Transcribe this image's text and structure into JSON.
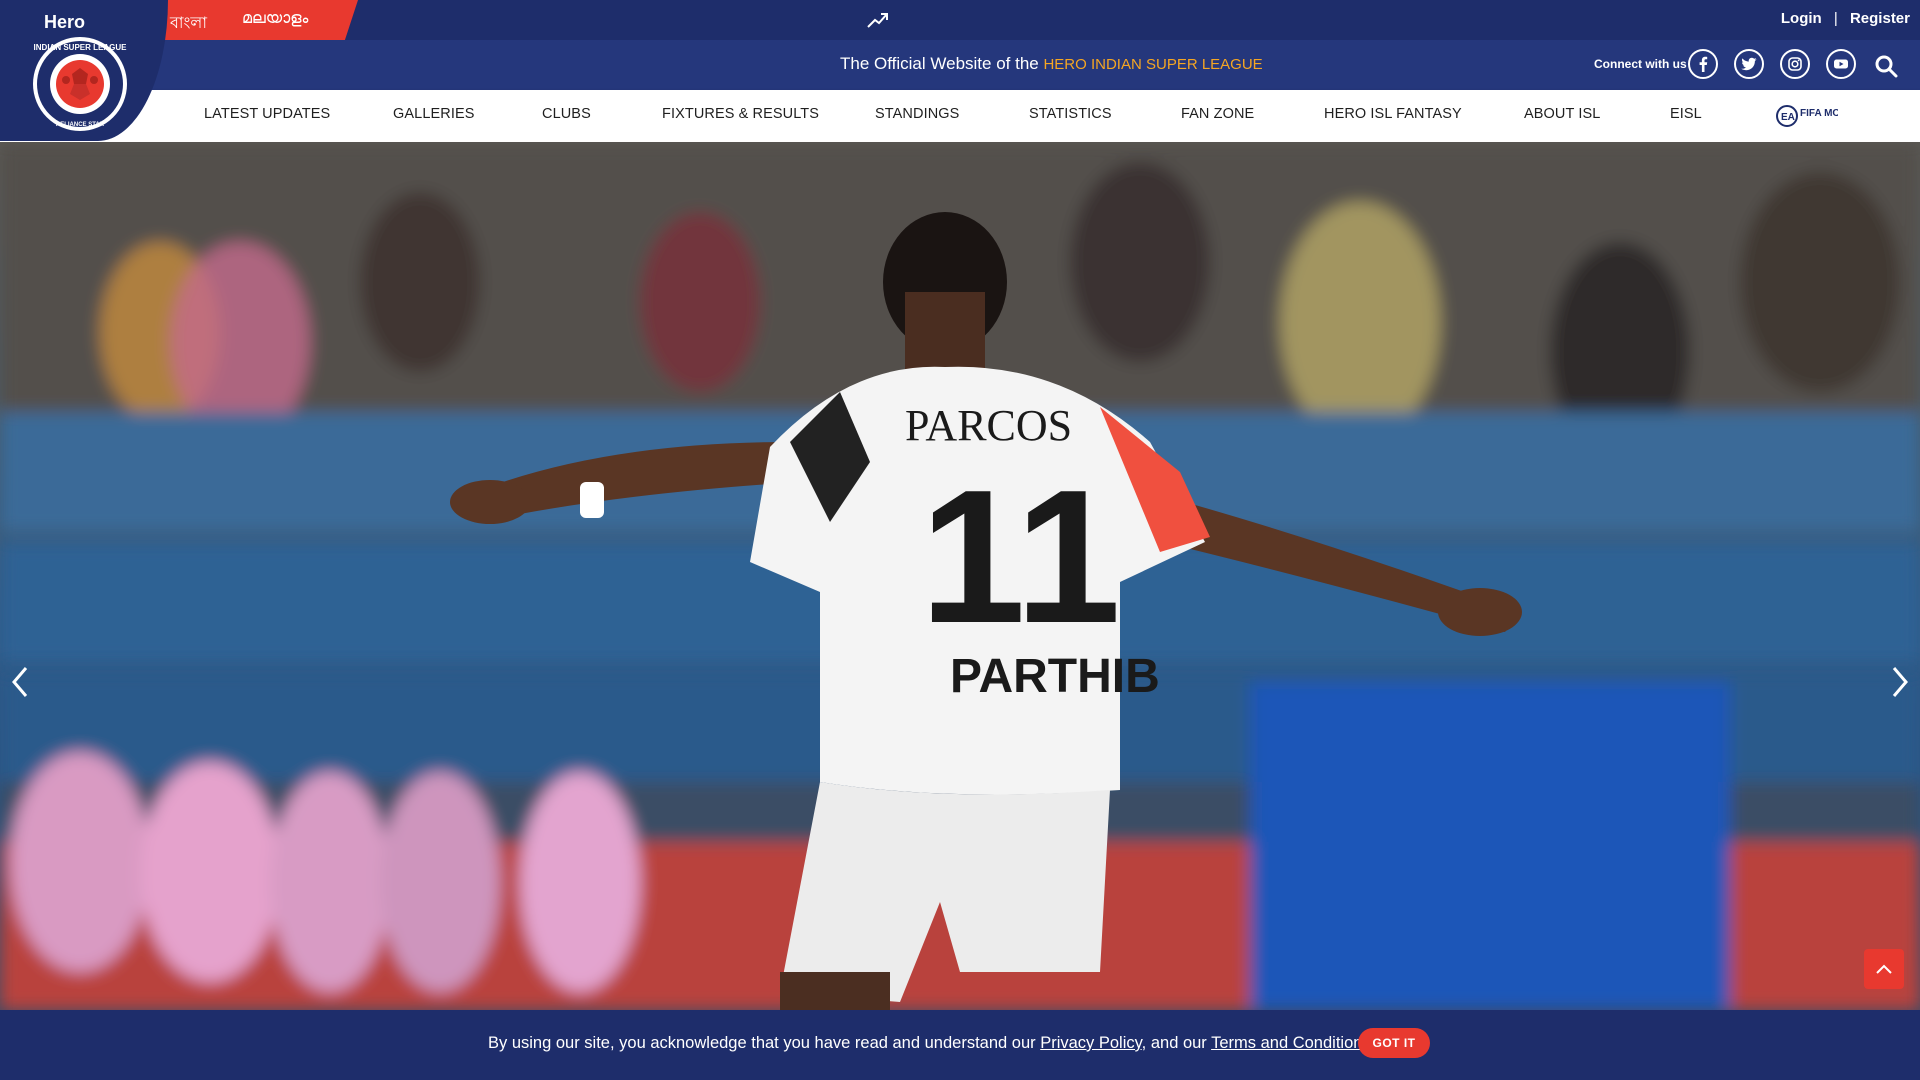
{
  "brand": {
    "hero_text": "Hero",
    "badge_text": "INDIAN SUPER LEAGUE",
    "badge_sub": "RELIANCE STAR"
  },
  "languages": [
    "বাংলা",
    "മലയാളം"
  ],
  "auth": {
    "login": "Login",
    "separator": "|",
    "register": "Register"
  },
  "tagline": {
    "prefix": "The Official Website of the ",
    "highlight": "HERO INDIAN SUPER LEAGUE"
  },
  "social": {
    "connect_label": "Connect with us",
    "icons": [
      "facebook-icon",
      "twitter-icon",
      "instagram-icon",
      "youtube-icon"
    ]
  },
  "nav": {
    "items": [
      "LATEST UPDATES",
      "GALLERIES",
      "CLUBS",
      "FIXTURES & RESULTS",
      "STANDINGS",
      "STATISTICS",
      "FAN ZONE",
      "HERO ISL FANTASY",
      "ABOUT ISL",
      "EISL"
    ],
    "fifa_badge": "FIFA MOBILE"
  },
  "hero": {
    "jersey_sponsor": "PARCOS",
    "jersey_number": "11",
    "jersey_name": "PARTHIB"
  },
  "cookie": {
    "text_before": "By using our site, you acknowledge that you have read and understand our ",
    "privacy_link": "Privacy Policy",
    "text_middle": ", and our ",
    "terms_link": "Terms and Conditions",
    "text_after": ".",
    "button": "GOT IT"
  },
  "colors": {
    "navy": "#1e2d6b",
    "navy_light": "#25377c",
    "accent_red": "#e8392f",
    "highlight_orange": "#f5a623"
  }
}
